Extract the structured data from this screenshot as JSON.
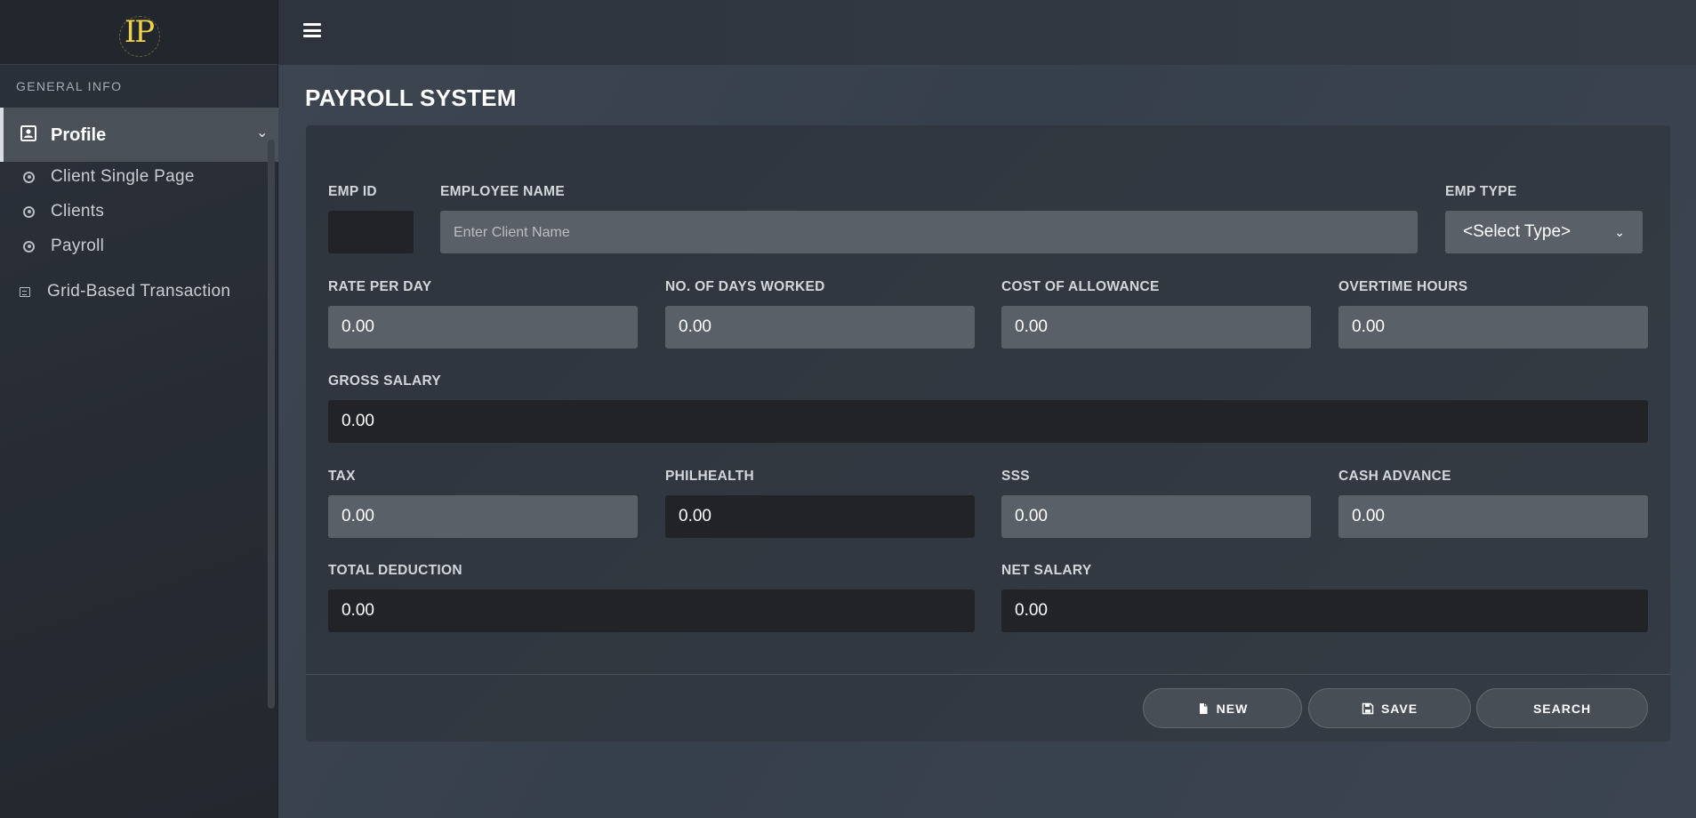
{
  "sidebar": {
    "logo": "IP",
    "section_title": "GENERAL INFO",
    "active_item": {
      "label": "Profile",
      "icon": "profile-card-icon"
    },
    "sub_items": [
      {
        "label": "Client Single Page",
        "icon": "radio-dot-icon"
      },
      {
        "label": "Clients",
        "icon": "radio-dot-icon"
      },
      {
        "label": "Payroll",
        "icon": "radio-dot-icon"
      }
    ],
    "grid_item": {
      "label": "Grid-Based Transaction",
      "icon": "grid-icon"
    }
  },
  "header": {
    "menu_icon": "hamburger-icon"
  },
  "page": {
    "title": "PAYROLL SYSTEM",
    "fields": {
      "emp_id": {
        "label": "EMP ID",
        "value": ""
      },
      "employee_name": {
        "label": "EMPLOYEE NAME",
        "value": "",
        "placeholder": "Enter Client Name"
      },
      "emp_type": {
        "label": "EMP TYPE",
        "value": "<Select Type>"
      },
      "rate_per_day": {
        "label": "RATE PER DAY",
        "value": "0.00"
      },
      "days_worked": {
        "label": "NO. OF DAYS WORKED",
        "value": "0.00"
      },
      "cost_of_allowance": {
        "label": "COST OF ALLOWANCE",
        "value": "0.00"
      },
      "overtime_hours": {
        "label": "OVERTIME HOURS",
        "value": "0.00"
      },
      "gross_salary": {
        "label": "GROSS SALARY",
        "value": "0.00"
      },
      "tax": {
        "label": "TAX",
        "value": "0.00"
      },
      "philhealth": {
        "label": "PHILHEALTH",
        "value": "0.00"
      },
      "sss": {
        "label": "SSS",
        "value": "0.00"
      },
      "cash_advance": {
        "label": "CASH ADVANCE",
        "value": "0.00"
      },
      "total_deduction": {
        "label": "TOTAL DEDUCTION",
        "value": "0.00"
      },
      "net_salary": {
        "label": "NET SALARY",
        "value": "0.00"
      }
    },
    "buttons": {
      "new": {
        "label": "NEW",
        "icon": "file-icon"
      },
      "save": {
        "label": "SAVE",
        "icon": "floppy-disk-icon"
      },
      "search": {
        "label": "SEARCH"
      }
    }
  },
  "colors": {
    "logo": "#f0d24a",
    "sidebar_bg": "#2b313a",
    "active_item_bg": "#4b5159",
    "main_bg": "#3d4550",
    "card_bg": "#2f353e",
    "input_light": "#5a6068",
    "input_dark": "#222327"
  }
}
